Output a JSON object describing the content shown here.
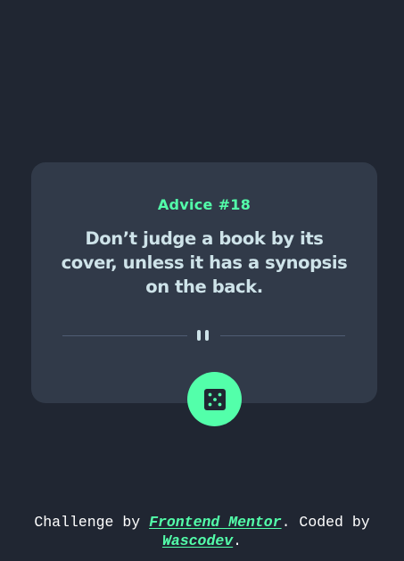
{
  "advice": {
    "id_label": "Advice #18",
    "text": "Don’t judge a book by its cover, unless it has a synopsis on the back."
  },
  "divider": {
    "icon": "pause-icon"
  },
  "dice_button": {
    "icon": "dice-icon"
  },
  "footer": {
    "prefix": "Challenge by ",
    "challenge_link": "Frontend Mentor",
    "middle": ". Coded by ",
    "author_link": "Wascodev",
    "suffix": "."
  },
  "colors": {
    "background": "#202632",
    "card": "#313a49",
    "accent": "#53ffaa",
    "quote_text": "#cee3e9",
    "divider": "#4f5d74",
    "dice_dots": "#202632",
    "footer_text": "#ffffff"
  }
}
